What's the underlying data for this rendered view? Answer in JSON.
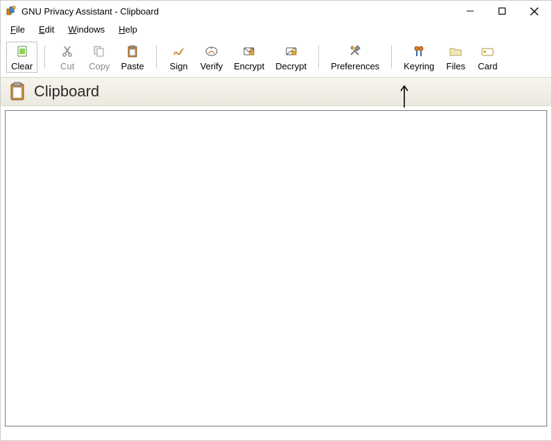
{
  "window": {
    "title": "GNU Privacy Assistant - Clipboard"
  },
  "menubar": {
    "file": "File",
    "edit": "Edit",
    "windows": "Windows",
    "help": "Help"
  },
  "toolbar": {
    "clear": "Clear",
    "cut": "Cut",
    "copy": "Copy",
    "paste": "Paste",
    "sign": "Sign",
    "verify": "Verify",
    "encrypt": "Encrypt",
    "decrypt": "Decrypt",
    "preferences": "Preferences",
    "keyring": "Keyring",
    "files": "Files",
    "card": "Card"
  },
  "header": {
    "title": "Clipboard"
  },
  "content": {
    "text": ""
  }
}
